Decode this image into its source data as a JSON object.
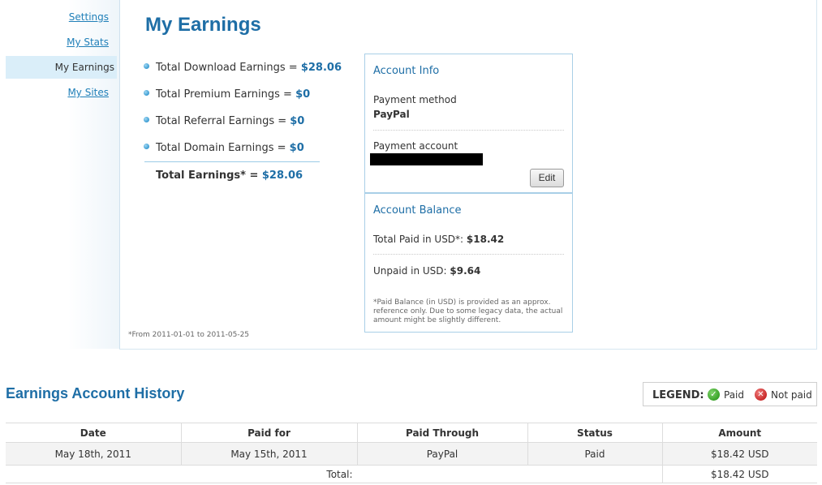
{
  "sidebar": {
    "items": [
      {
        "label": "Settings"
      },
      {
        "label": "My Stats"
      },
      {
        "label": "My Earnings"
      },
      {
        "label": "My Sites"
      }
    ]
  },
  "page": {
    "title": "My Earnings",
    "earnings": [
      {
        "label": "Total Download Earnings =",
        "value": "$28.06"
      },
      {
        "label": "Total Premium Earnings =",
        "value": "$0"
      },
      {
        "label": "Total Referral Earnings =",
        "value": "$0"
      },
      {
        "label": "Total Domain Earnings =",
        "value": "$0"
      }
    ],
    "total_label": "Total Earnings* =",
    "total_value": "$28.06",
    "date_note": "*From 2011-01-01 to 2011-05-25"
  },
  "account_info": {
    "title": "Account Info",
    "payment_method_label": "Payment method",
    "payment_method_value": "PayPal",
    "payment_account_label": "Payment account",
    "edit_label": "Edit"
  },
  "account_balance": {
    "title": "Account Balance",
    "total_paid_label": "Total Paid in USD*:",
    "total_paid_value": "$18.42",
    "unpaid_label": "Unpaid in USD:",
    "unpaid_value": "$9.64",
    "note": "*Paid Balance (in USD) is provided as an approx. reference only. Due to some legacy data, the actual amount might be slightly different."
  },
  "history": {
    "title": "Earnings Account History",
    "legend": {
      "title": "LEGEND:",
      "paid": "Paid",
      "not_paid": "Not paid"
    },
    "columns": [
      "Date",
      "Paid for",
      "Paid Through",
      "Status",
      "Amount"
    ],
    "rows": [
      [
        "May 18th, 2011",
        "May 15th, 2011",
        "PayPal",
        "Paid",
        "$18.42 USD"
      ]
    ],
    "total_label": "Total:",
    "total_value": "$18.42 USD"
  },
  "colors": {
    "accent": "#1e6ea6",
    "link": "#1f7fb8",
    "active_bg": "#daeef9"
  }
}
